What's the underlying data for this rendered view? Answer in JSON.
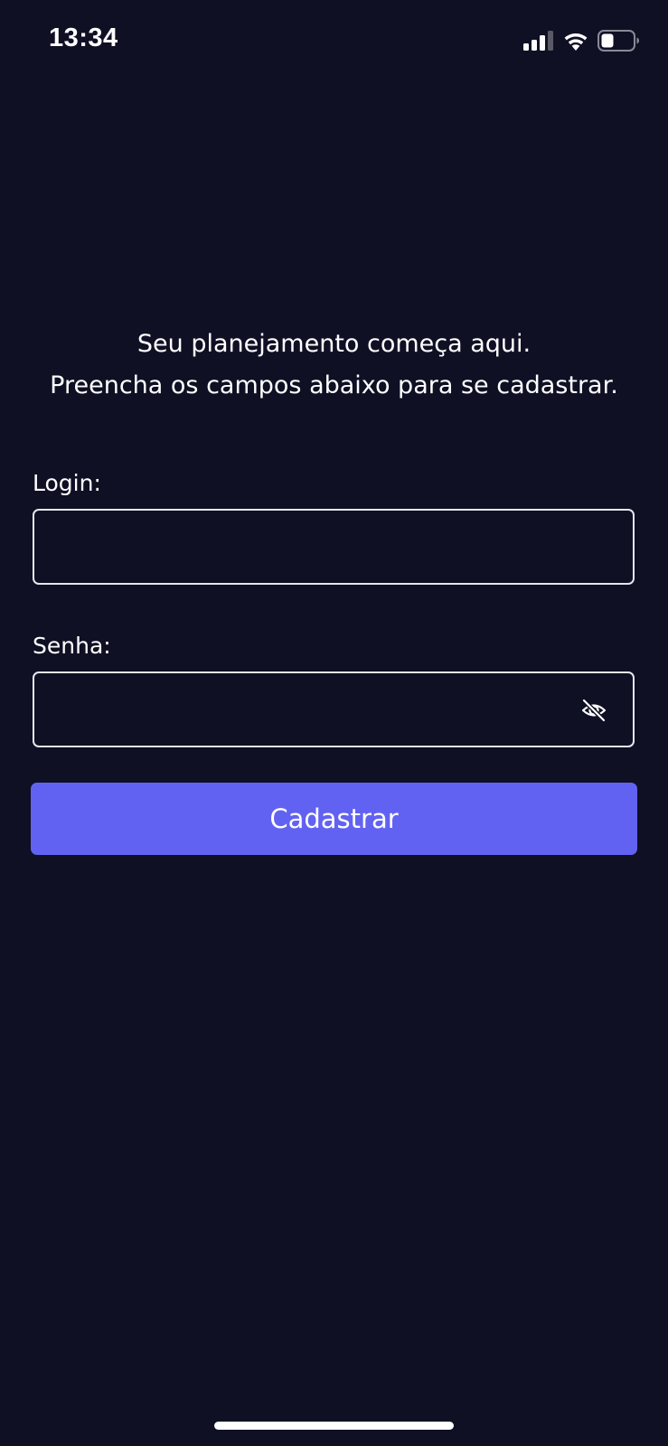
{
  "status_bar": {
    "time": "13:34",
    "icons": [
      "signal-icon",
      "wifi-icon",
      "battery-icon"
    ]
  },
  "heading": {
    "line1": "Seu planejamento começa aqui.",
    "line2": "Preencha os campos abaixo para se cadastrar."
  },
  "form": {
    "login": {
      "label": "Login:",
      "value": ""
    },
    "password": {
      "label": "Senha:",
      "value": "",
      "toggle_icon": "eye-off-icon"
    },
    "submit_label": "Cadastrar"
  },
  "colors": {
    "background": "#0f1024",
    "accent": "#6262f2",
    "field_border": "#e6e6ee",
    "text": "#ffffff"
  }
}
